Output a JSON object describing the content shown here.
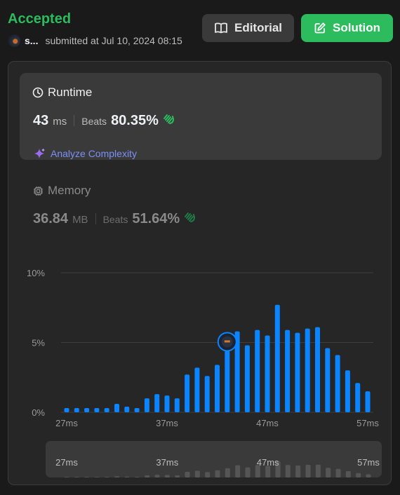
{
  "header": {
    "status": "Accepted",
    "user": "s...",
    "submitted_text": "submitted at Jul 10, 2024 08:15",
    "editorial_label": "Editorial",
    "solution_label": "Solution"
  },
  "runtime": {
    "title": "Runtime",
    "value": "43",
    "unit": "ms",
    "beats_label": "Beats",
    "beats_value": "80.35%",
    "analyze_label": "Analyze Complexity"
  },
  "memory": {
    "title": "Memory",
    "value": "36.84",
    "unit": "MB",
    "beats_label": "Beats",
    "beats_value": "51.64%"
  },
  "colors": {
    "accent_green": "#2cbb5d",
    "bar_blue": "#0a84ff",
    "analyze_purple": "#7c8ff7"
  },
  "chart_data": {
    "type": "bar",
    "xlabel": "",
    "ylabel": "",
    "y_ticks": [
      "0%",
      "5%",
      "10%"
    ],
    "ylim": [
      0,
      10
    ],
    "x_tick_labels": [
      "27ms",
      "37ms",
      "47ms",
      "57ms"
    ],
    "x_tick_values": [
      27,
      37,
      47,
      57
    ],
    "highlighted_x": 43,
    "grid": true,
    "series": [
      {
        "x": [
          27,
          28,
          29,
          30,
          31,
          32,
          33,
          34,
          35,
          36,
          37,
          38,
          39,
          40,
          41,
          42,
          43,
          44,
          45,
          46,
          47,
          48,
          49,
          50,
          51,
          52,
          53,
          54,
          55,
          56,
          57
        ],
        "values": [
          0.3,
          0.3,
          0.3,
          0.3,
          0.3,
          0.6,
          0.4,
          0.3,
          1.0,
          1.3,
          1.2,
          1.0,
          2.7,
          3.2,
          2.6,
          3.4,
          4.4,
          5.8,
          4.8,
          5.9,
          5.5,
          7.7,
          5.9,
          5.7,
          6.0,
          6.1,
          4.6,
          4.1,
          3.0,
          2.1,
          1.5
        ]
      }
    ],
    "mini_x_tick_labels": [
      "27ms",
      "37ms",
      "47ms",
      "57ms"
    ]
  }
}
